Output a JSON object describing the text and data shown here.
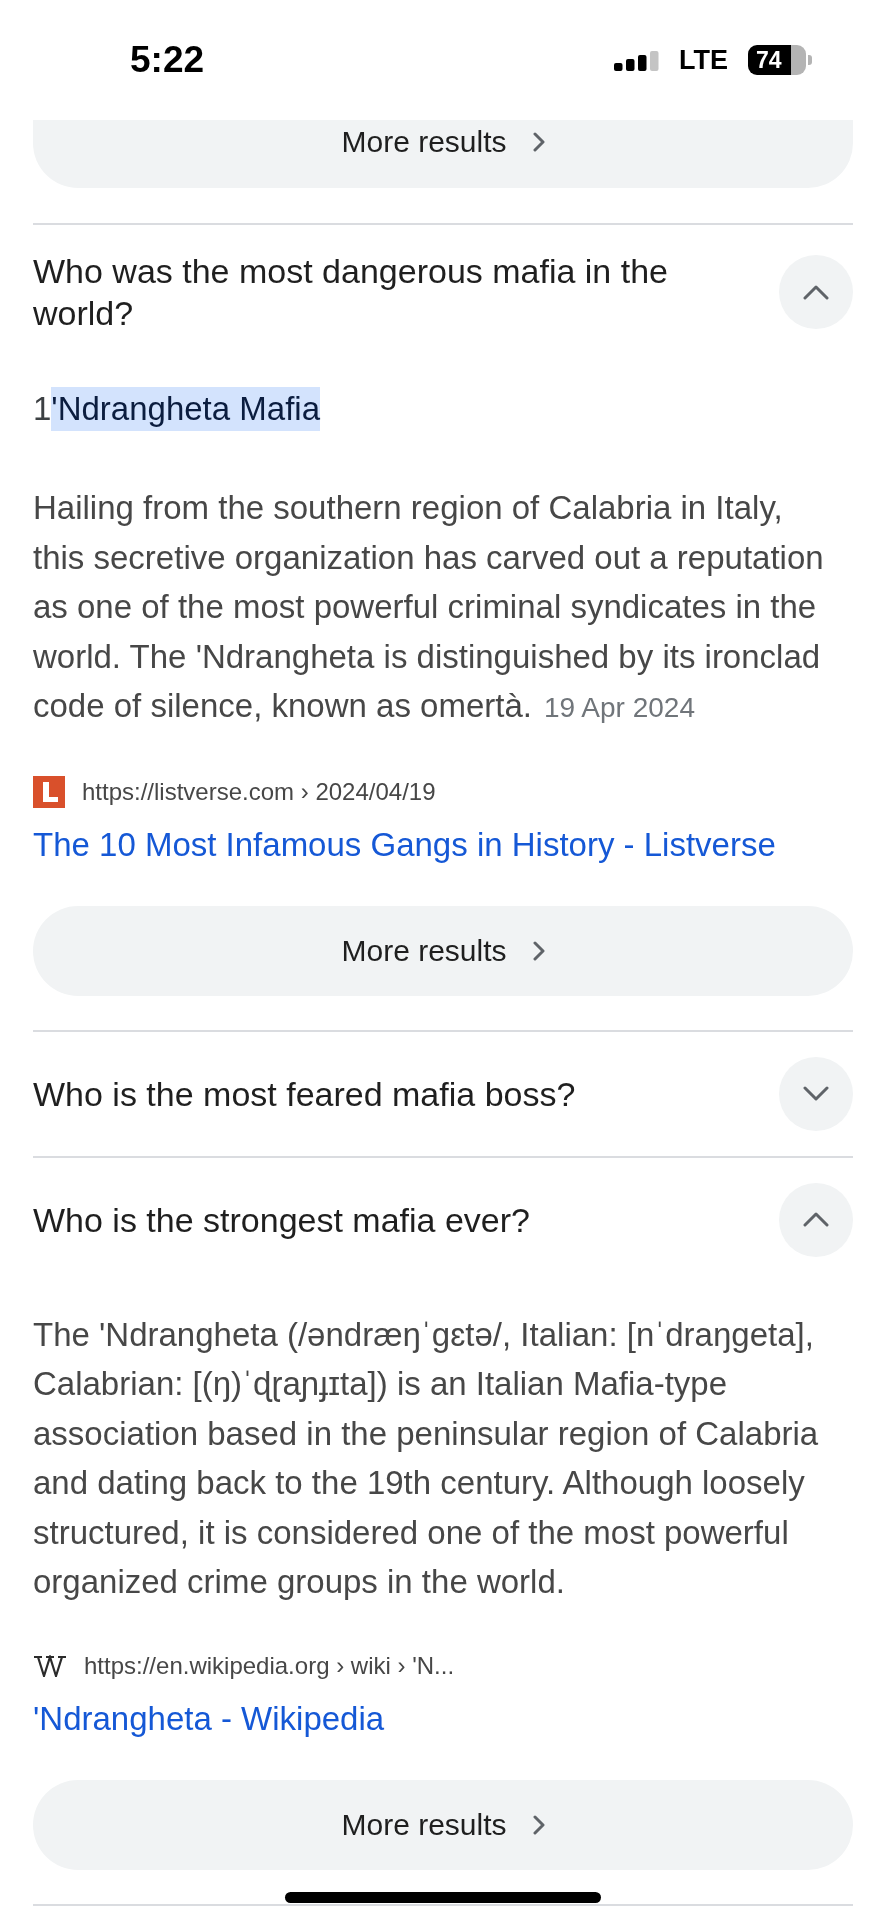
{
  "status_bar": {
    "time": "5:22",
    "network": "LTE",
    "battery": "74"
  },
  "top_button": {
    "label": "More results"
  },
  "faqs": [
    {
      "question": "Who was the most dangerous mafia in the world?",
      "expanded": true,
      "answer": {
        "heading": [
          {
            "text": "1",
            "selected": false
          },
          {
            "text": "'Ndrangheta Mafia",
            "selected": true
          }
        ],
        "text": "Hailing from the southern region of Calabria in Italy, this secretive organization has carved out a reputation as one of the most powerful criminal syndicates in the world. The 'Ndrangheta is distinguished by its ironclad code of silence, known as omertà.",
        "date": "19 Apr 2024",
        "source": {
          "kind": "tile",
          "url": "https://listverse.com › 2024/04/19",
          "title": "The 10 Most Infamous Gangs in History - Listverse"
        },
        "button": "More results"
      }
    },
    {
      "question": "Who is the most feared mafia boss?",
      "expanded": false
    },
    {
      "question": "Who is the strongest mafia ever?",
      "expanded": true,
      "answer": {
        "text": "The 'Ndrangheta (/əndræŋˈgɛtə/, Italian: [nˈdraŋgeta], Calabrian: [(ŋ)ˈɖɽaɲɟɪta]) is an Italian Mafia-type association based in the peninsular region of Calabria and dating back to the 19th century. Although loosely structured, it is considered one of the most powerful organized crime groups in the world.",
        "source": {
          "kind": "glyph",
          "url": "https://en.wikipedia.org › wiki › 'N...",
          "title": "'Ndrangheta - Wikipedia"
        },
        "button": "More results"
      }
    }
  ]
}
